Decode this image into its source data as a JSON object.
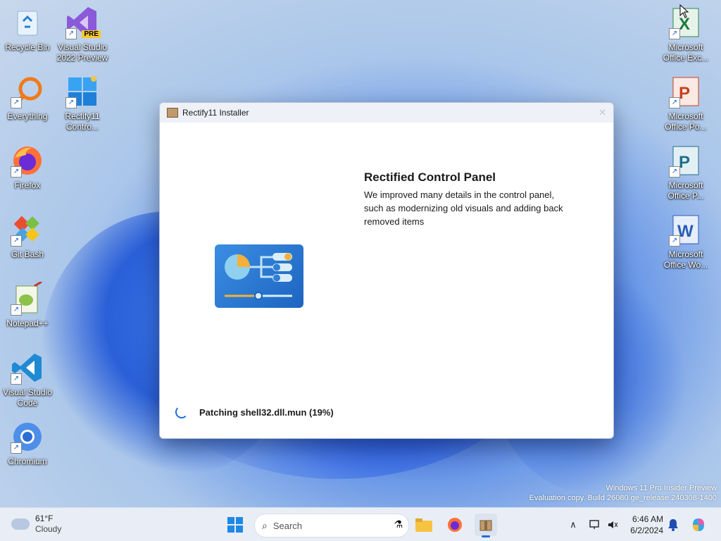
{
  "desktop": {
    "icons_left": [
      {
        "label": "Recycle Bin",
        "icon": "recycle-bin-icon"
      },
      {
        "label": "Everything",
        "icon": "everything-icon"
      },
      {
        "label": "Firefox",
        "icon": "firefox-icon"
      },
      {
        "label": "Git Bash",
        "icon": "git-bash-icon"
      },
      {
        "label": "Notepad++",
        "icon": "notepadpp-icon"
      },
      {
        "label": "Visual Studio Code",
        "icon": "vscode-icon"
      },
      {
        "label": "Chromium",
        "icon": "chromium-icon"
      }
    ],
    "icons_col2": [
      {
        "label": "Visual Studio 2022 Preview",
        "icon": "visual-studio-icon",
        "badge": "PRE"
      },
      {
        "label": "Rectify11 Contro...",
        "icon": "rectify11-icon"
      }
    ],
    "icons_right": [
      {
        "label": "Microsoft Office Exc...",
        "icon": "excel-icon"
      },
      {
        "label": "Microsoft Office Po...",
        "icon": "powerpoint-icon"
      },
      {
        "label": "Microsoft Office P...",
        "icon": "publisher-icon"
      },
      {
        "label": "Microsoft Office Wo...",
        "icon": "word-icon"
      }
    ],
    "watermark_line1": "Windows 11 Pro Insider Preview",
    "watermark_line2": "Evaluation copy. Build 26080.ge_release.240308-1400"
  },
  "installer": {
    "title": "Rectify11 Installer",
    "heading": "Rectified Control Panel",
    "description": "We improved many details in the control panel, such as modernizing old visuals and adding back removed items",
    "status": "Patching shell32.dll.mun (19%)",
    "progress_percent": 19
  },
  "taskbar": {
    "weather_temp": "61°F",
    "weather_cond": "Cloudy",
    "search_placeholder": "Search",
    "time": "6:46 AM",
    "date": "6/2/2024"
  },
  "colors": {
    "accent": "#1e6fd6",
    "taskbar": "#e9eef6"
  }
}
